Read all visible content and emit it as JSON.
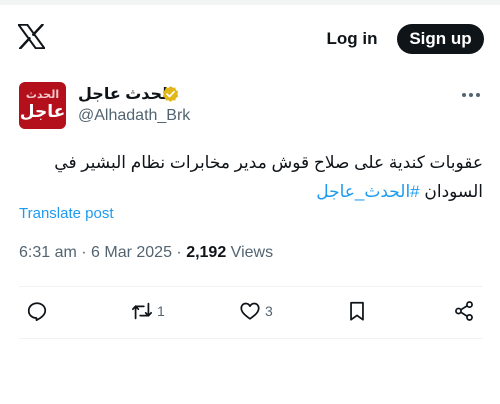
{
  "header": {
    "login_label": "Log in",
    "signup_label": "Sign up"
  },
  "tweet": {
    "avatar_text_top": "الحدث",
    "avatar_text_bottom": "عاجل",
    "display_name": "الحدث عاجل",
    "handle": "@Alhadath_Brk",
    "text_line1": "عقوبات كندية على صلاح قوش مدير مخابرات نظام  البشير في",
    "text_line2_prefix": "السودان ",
    "hashtag": "#الحدث_عاجل",
    "translate_label": "Translate post",
    "time": "6:31 am",
    "separator": " · ",
    "date": "6 Mar 2025",
    "views_count": "2,192",
    "views_label": " Views"
  },
  "actions": {
    "reply_count": "",
    "repost_count": "1",
    "like_count": "3"
  },
  "colors": {
    "accent": "#1d9bf0",
    "verified_gold": "#e2b719",
    "text_primary": "#0f1419",
    "text_secondary": "#536471",
    "avatar_bg": "#b3101b"
  },
  "icons": [
    "x-logo-icon",
    "verified-badge-icon",
    "more-icon",
    "reply-icon",
    "repost-icon",
    "like-icon",
    "bookmark-icon",
    "share-icon"
  ]
}
